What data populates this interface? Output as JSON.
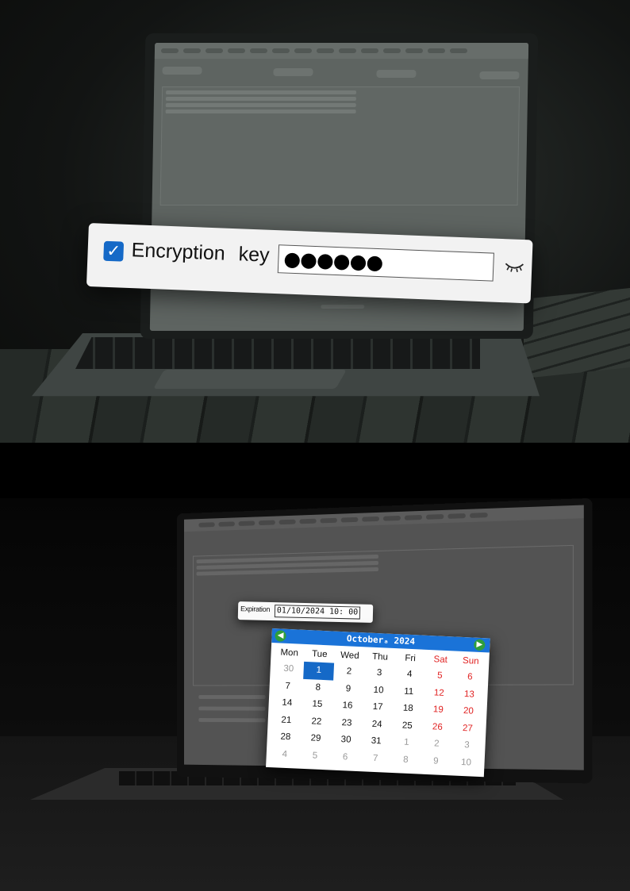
{
  "encryption": {
    "checkbox_checked": true,
    "label": "Encryption key",
    "masked_value": "●●●●●●",
    "toggle_icon": "eye-closed-icon",
    "accent_color": "#1569c7"
  },
  "expiration": {
    "label": "Expiration",
    "value": "01/10/2024 10: 00"
  },
  "calendar": {
    "month_year": "Octoberₐ 2024",
    "prev_icon": "arrow-left-icon",
    "next_icon": "arrow-right-icon",
    "header_color": "#1a73d8",
    "weekend_color": "#e02020",
    "weekdays": [
      "Mon",
      "Tue",
      "Wed",
      "Thu",
      "Fri",
      "Sat",
      "Sun"
    ],
    "weeks": [
      [
        "30",
        "1",
        "2",
        "3",
        "4",
        "5",
        "6"
      ],
      [
        "7",
        "8",
        "9",
        "10",
        "11",
        "12",
        "13"
      ],
      [
        "14",
        "15",
        "16",
        "17",
        "18",
        "19",
        "20"
      ],
      [
        "21",
        "22",
        "23",
        "24",
        "25",
        "26",
        "27"
      ],
      [
        "28",
        "29",
        "30",
        "31",
        "1",
        "2",
        "3"
      ],
      [
        "4",
        "5",
        "6",
        "7",
        "8",
        "9",
        "10"
      ]
    ],
    "selected_day": "1"
  }
}
